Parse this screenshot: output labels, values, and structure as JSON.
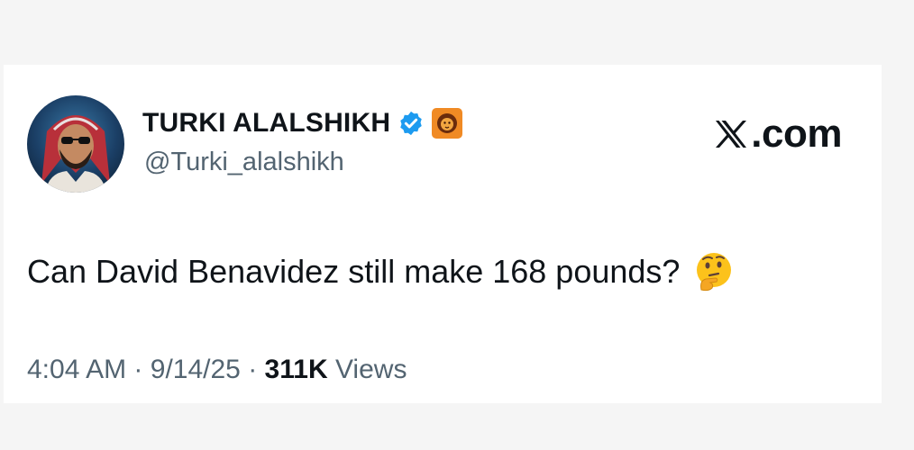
{
  "tweet": {
    "author": {
      "display_name": "TURKI ALALSHIKH",
      "handle": "@Turki_alalshikh",
      "verified_icon": "verified-badge-icon",
      "affiliate_icon": "lion-org-badge-icon"
    },
    "brand": {
      "logo_icon": "x-logo-icon",
      "text": ".com"
    },
    "body_text": "Can David Benavidez still make 168 pounds?",
    "emoji_icon": "thinking-face-icon",
    "meta": {
      "time": "4:04 AM",
      "separator": "·",
      "date": "9/14/25",
      "views_count": "311K",
      "views_label": "Views"
    }
  },
  "colors": {
    "background": "#f5f5f5",
    "card": "#ffffff",
    "text_primary": "#0f1419",
    "text_secondary": "#536471",
    "verified_blue": "#1d9bf0",
    "org_orange": "#f08a24"
  }
}
